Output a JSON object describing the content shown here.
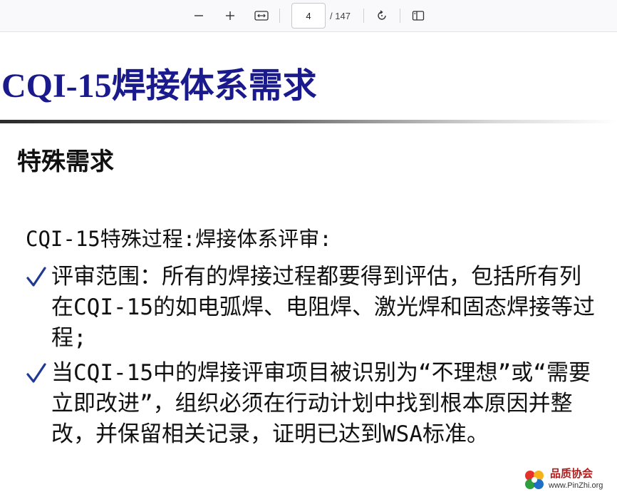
{
  "toolbar": {
    "zoom_out_icon": "minus-icon",
    "zoom_in_icon": "plus-icon",
    "fit_width_icon": "fit-width-icon",
    "page_number": "4",
    "page_total": "/ 147",
    "rotate_icon": "rotate-icon",
    "sidebar_icon": "sidebar-icon"
  },
  "slide": {
    "title": "CQI-15焊接体系需求",
    "subtitle": "特殊需求",
    "intro": "CQI-15特殊过程:焊接体系评审:",
    "bullets": [
      {
        "text": "评审范围：所有的焊接过程都要得到评估，包括所有列在CQI-15的如电弧焊、电阻焊、激光焊和固态焊接等过程;"
      },
      {
        "text": "当CQI-15中的焊接评审项目被识别为“不理想”或“需要立即改进”，组织必须在行动计划中找到根本原因并整改，并保留相关记录，证明已达到WSA标准。"
      }
    ],
    "title_color": "#1a1a8c",
    "check_color": "#1f3a93"
  },
  "watermark": {
    "name": "品质协会",
    "url": "www.PinZhi.org"
  }
}
